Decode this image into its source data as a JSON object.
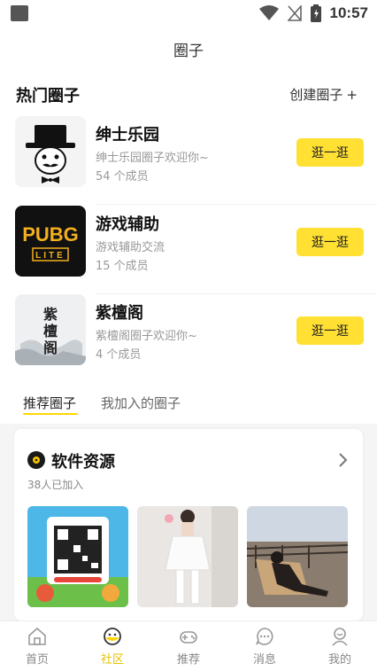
{
  "status_bar": {
    "time": "10:57"
  },
  "page_title": "圈子",
  "hot": {
    "title": "热门圈子",
    "create_label": "创建圈子",
    "create_plus": "+",
    "circles": [
      {
        "name": "绅士乐园",
        "desc": "绅士乐园圈子欢迎你~",
        "members": "54 个成员",
        "button": "逛一逛",
        "thumb": "gentleman-hat-icon"
      },
      {
        "name": "游戏辅助",
        "desc": "游戏辅助交流",
        "members": "15 个成员",
        "button": "逛一逛",
        "thumb": "pubg-lite-logo",
        "logo_text": [
          "PUBG",
          "LITE"
        ]
      },
      {
        "name": "紫檀阁",
        "desc": "紫檀阁圈子欢迎你~",
        "members": "4 个成员",
        "button": "逛一逛",
        "thumb": "zitan-calligraphy",
        "logo_text": [
          "紫",
          "檀",
          "阁"
        ]
      }
    ]
  },
  "tabs": [
    {
      "label": "推荐圈子",
      "active": true
    },
    {
      "label": "我加入的圈子",
      "active": false
    }
  ],
  "card": {
    "title": "软件资源",
    "joined": "38人已加入",
    "icon": "vinyl-disc-icon",
    "images": [
      "qr-promo-image",
      "girl-white-dress-image",
      "man-on-chair-image"
    ]
  },
  "bottom_nav": [
    {
      "label": "首页",
      "icon": "home-icon",
      "active": false
    },
    {
      "label": "社区",
      "icon": "community-icon",
      "active": true
    },
    {
      "label": "推荐",
      "icon": "gamepad-icon",
      "active": false
    },
    {
      "label": "消息",
      "icon": "message-icon",
      "active": false
    },
    {
      "label": "我的",
      "icon": "profile-icon",
      "active": false
    }
  ],
  "colors": {
    "accent": "#ffe033",
    "active_nav": "#e6c200",
    "muted_text": "#999999"
  }
}
